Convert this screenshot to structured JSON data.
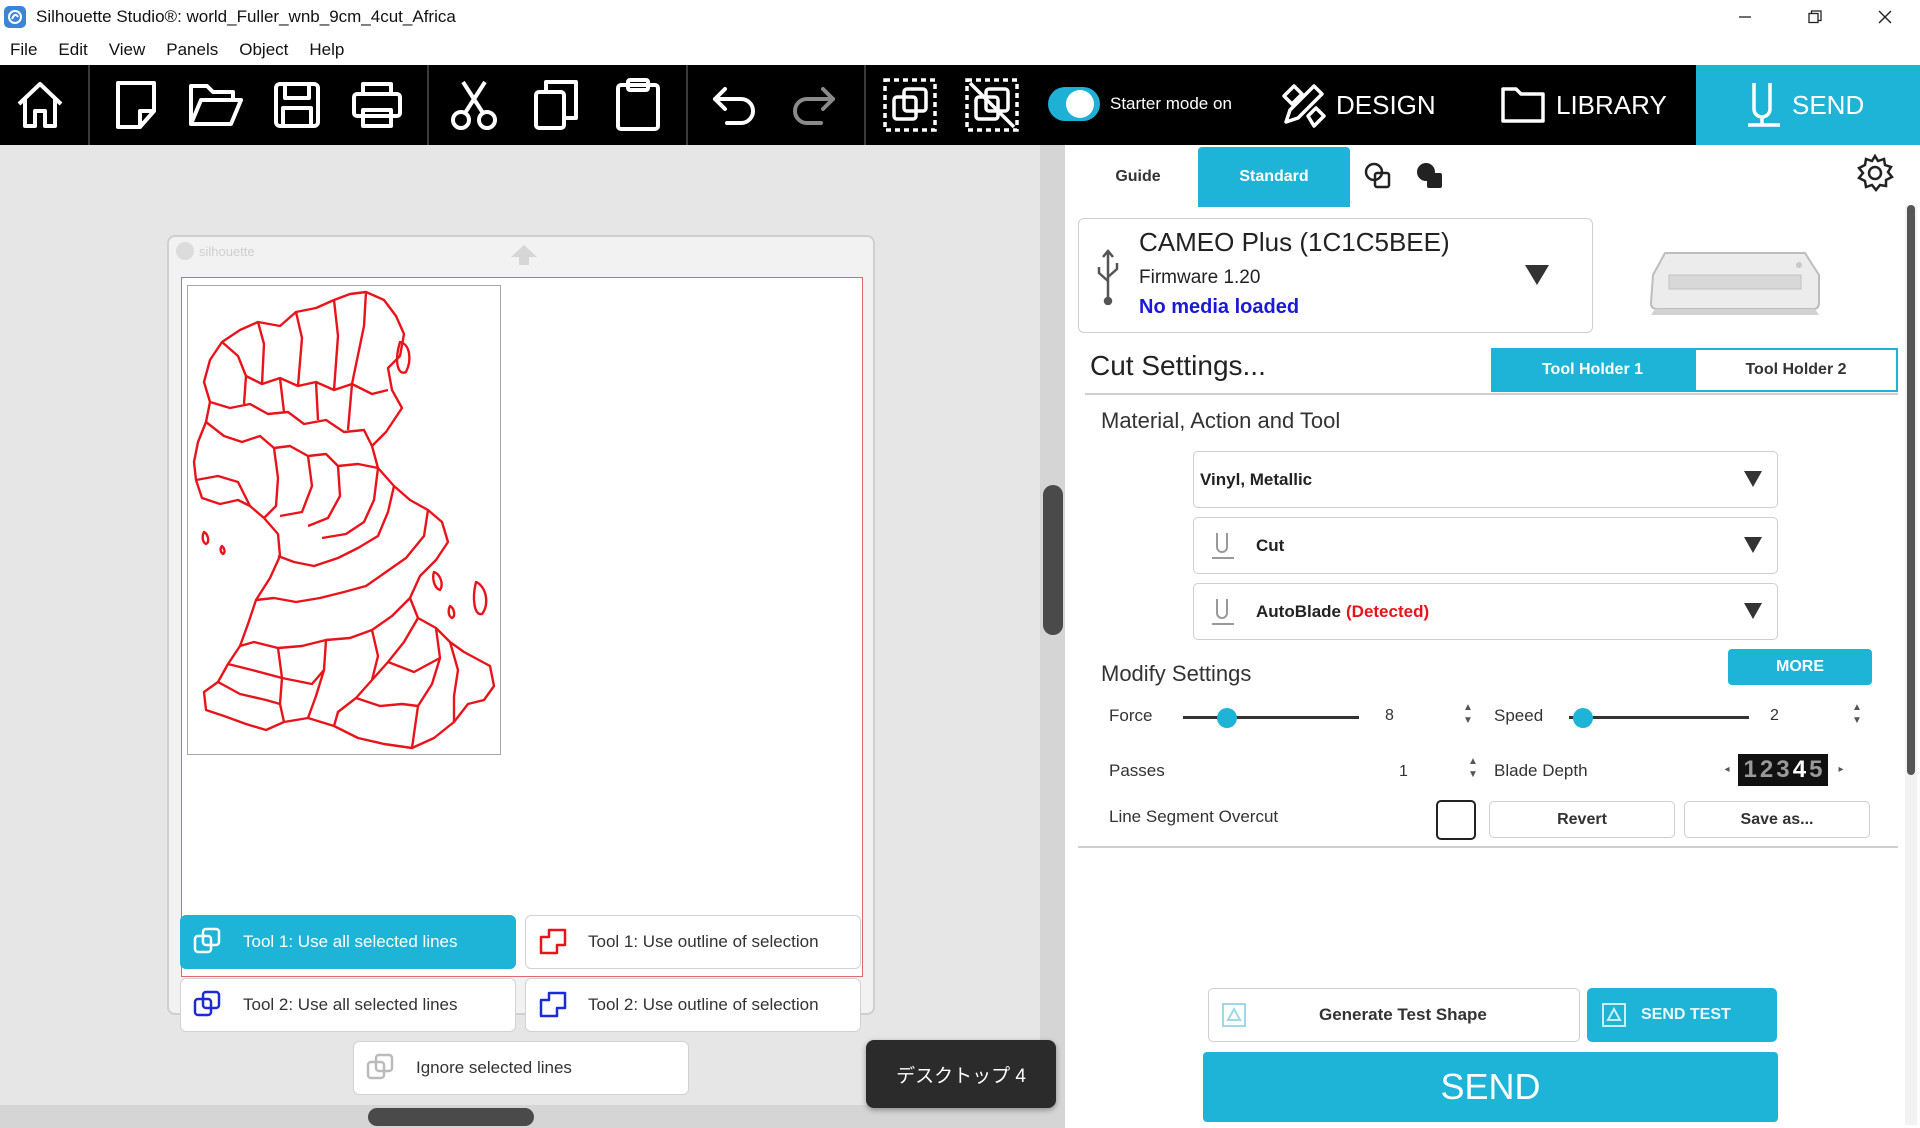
{
  "window": {
    "title": "Silhouette Studio®: world_Fuller_wnb_9cm_4cut_Africa",
    "controls": [
      "minimize",
      "restore",
      "close"
    ]
  },
  "menu": [
    "File",
    "Edit",
    "View",
    "Panels",
    "Object",
    "Help"
  ],
  "toolbar": {
    "starter_mode_label": "Starter mode on",
    "tabs": {
      "design": "DESIGN",
      "library": "LIBRARY",
      "send": "SEND"
    }
  },
  "canvas": {
    "mat_brand": "silhouette",
    "line_options": {
      "tool1_all": "Tool 1: Use all selected lines",
      "tool1_outline": "Tool 1: Use outline of selection",
      "tool2_all": "Tool 2: Use all selected lines",
      "tool2_outline": "Tool 2: Use outline of selection",
      "ignore": "Ignore selected lines"
    },
    "desktop_tooltip": "デスクトップ 4"
  },
  "send_panel": {
    "tabs": {
      "guide": "Guide",
      "standard": "Standard"
    },
    "device": {
      "name": "CAMEO Plus (1C1C5BEE)",
      "firmware": "Firmware 1.20",
      "media_status": "No media loaded"
    },
    "cut_settings_title": "Cut Settings...",
    "tool_holders": {
      "th1": "Tool Holder 1",
      "th2": "Tool Holder 2"
    },
    "material_section": "Material, Action and Tool",
    "material": "Vinyl, Metallic",
    "action": "Cut",
    "tool": "AutoBlade",
    "tool_status": "(Detected)",
    "modify_section": "Modify Settings",
    "more_label": "MORE",
    "force": {
      "label": "Force",
      "value": "8",
      "fraction": 0.25
    },
    "speed": {
      "label": "Speed",
      "value": "2",
      "fraction": 0.08
    },
    "passes": {
      "label": "Passes",
      "value": "1"
    },
    "blade_depth": {
      "label": "Blade Depth",
      "digits": [
        "1",
        "2",
        "3",
        "4",
        "5"
      ]
    },
    "overcut_label": "Line Segment Overcut",
    "revert_label": "Revert",
    "saveas_label": "Save as...",
    "generate_test_label": "Generate Test Shape",
    "send_test_label": "SEND TEST",
    "send_label": "SEND"
  },
  "colors": {
    "accent": "#1db4d8",
    "cut_line": "#e8141b",
    "media_status": "#1a1ad6",
    "detected": "#e8141b"
  }
}
